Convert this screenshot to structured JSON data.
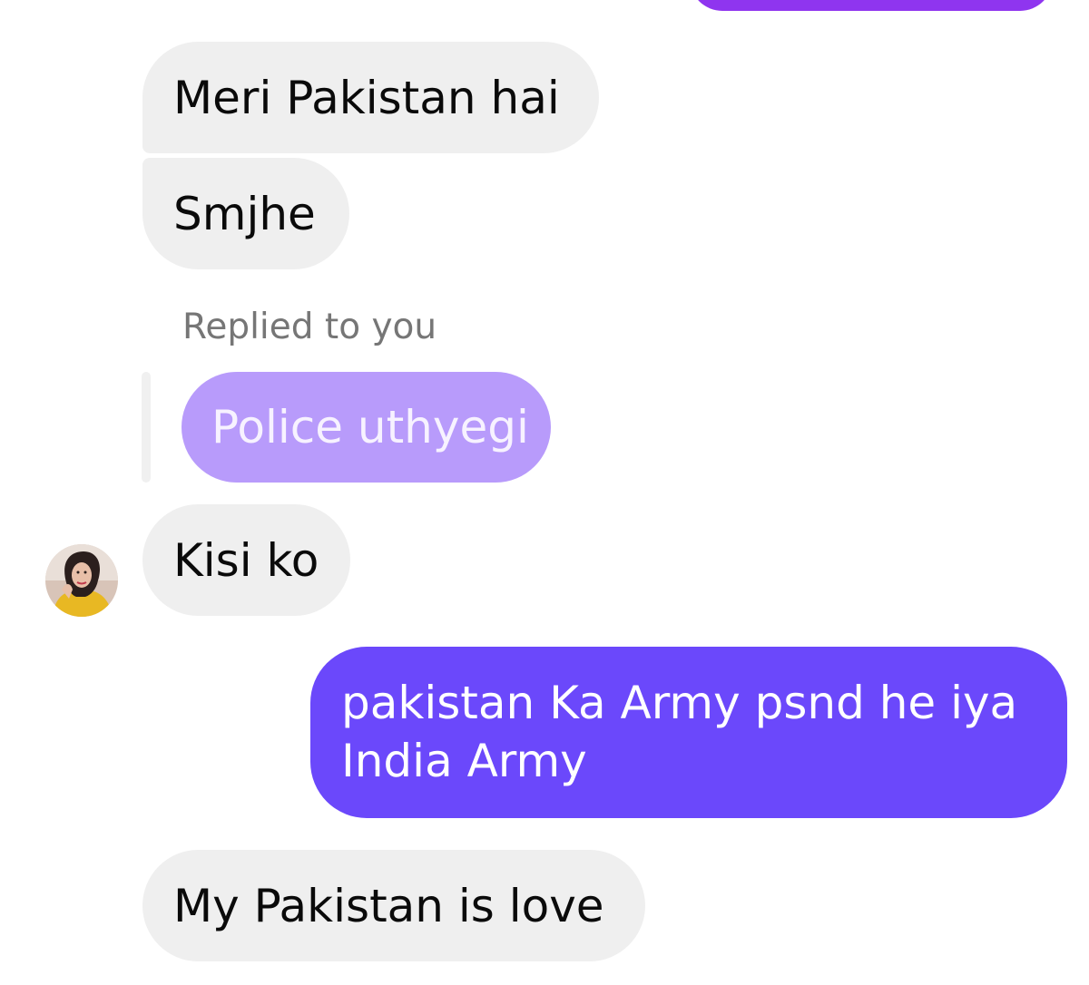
{
  "messages": {
    "m1": "Meri Pakistan hai",
    "m2": "Smjhe",
    "reply_label": "Replied to you",
    "quoted": "Police uthyegi",
    "m3": "Kisi ko",
    "m4": "pakistan Ka Army psnd he iya India Army",
    "m5": "My Pakistan is love"
  },
  "colors": {
    "incoming_bg": "#efefef",
    "outgoing_bg": "#6b48fb",
    "quoted_bg": "#b89bfb",
    "top_peek": "#8f35ef"
  }
}
